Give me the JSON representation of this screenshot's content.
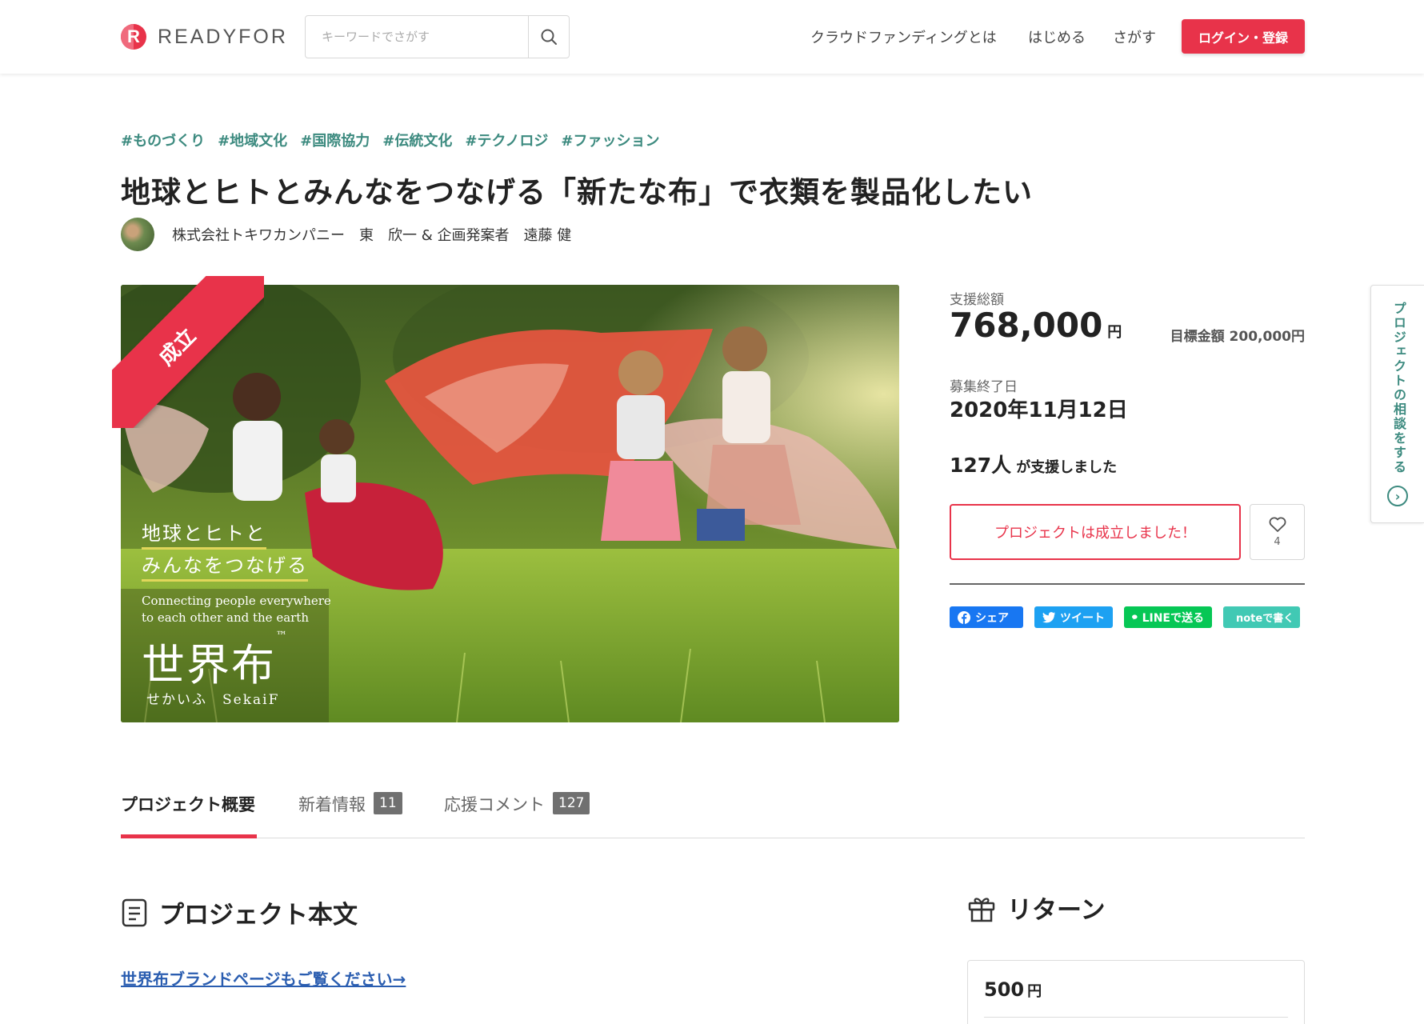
{
  "header": {
    "logo_text": "READYFOR",
    "search_placeholder": "キーワードでさがす",
    "nav": {
      "about": "クラウドファンディングとは",
      "start": "はじめる",
      "find": "さがす",
      "login": "ログイン・登録"
    }
  },
  "project": {
    "tags": [
      "#ものづくり",
      "#地域文化",
      "#国際協力",
      "#伝統文化",
      "#テクノロジ",
      "#ファッション"
    ],
    "title": "地球とヒトとみんなをつなげる「新たな布」で衣類を製品化したい",
    "owner": "株式会社トキワカンパニー　東　欣一 & 企画発案者　遠藤 健",
    "ribbon": "成立",
    "image_overlay": {
      "line1": "地球とヒトと",
      "line2": "みんなをつなげる",
      "en1": "Connecting people everywhere",
      "en2": "to each other and the earth",
      "brand": "世界布",
      "brand_mark": "™",
      "sub": "せかいふ　SekaiF"
    }
  },
  "stats": {
    "amount_label": "支援総額",
    "amount": "768,000",
    "amount_unit": "円",
    "goal": "目標金額 200,000円",
    "end_label": "募集終了日",
    "end_date": "2020年11月12日",
    "backers_count": "127人",
    "backers_text": "が支援しました",
    "success_button": "プロジェクトは成立しました！",
    "like_count": "4"
  },
  "share": {
    "facebook": "シェア",
    "twitter": "ツイート",
    "line": "LINEで送る",
    "note": "noteで書く"
  },
  "consult_tab": "プロジェクトの相談をする",
  "tabs": {
    "overview": "プロジェクト概要",
    "news": "新着情報",
    "news_count": "11",
    "comments": "応援コメント",
    "comments_count": "127"
  },
  "sections": {
    "body_title": "プロジェクト本文",
    "brand_link": "世界布ブランドページもご覧ください→",
    "return_title": "リターン",
    "return_price": "500",
    "return_unit": "円"
  },
  "colors": {
    "brand_red": "#e8334a",
    "tag_teal": "#3c8a7f",
    "link_blue": "#2a5db0"
  }
}
